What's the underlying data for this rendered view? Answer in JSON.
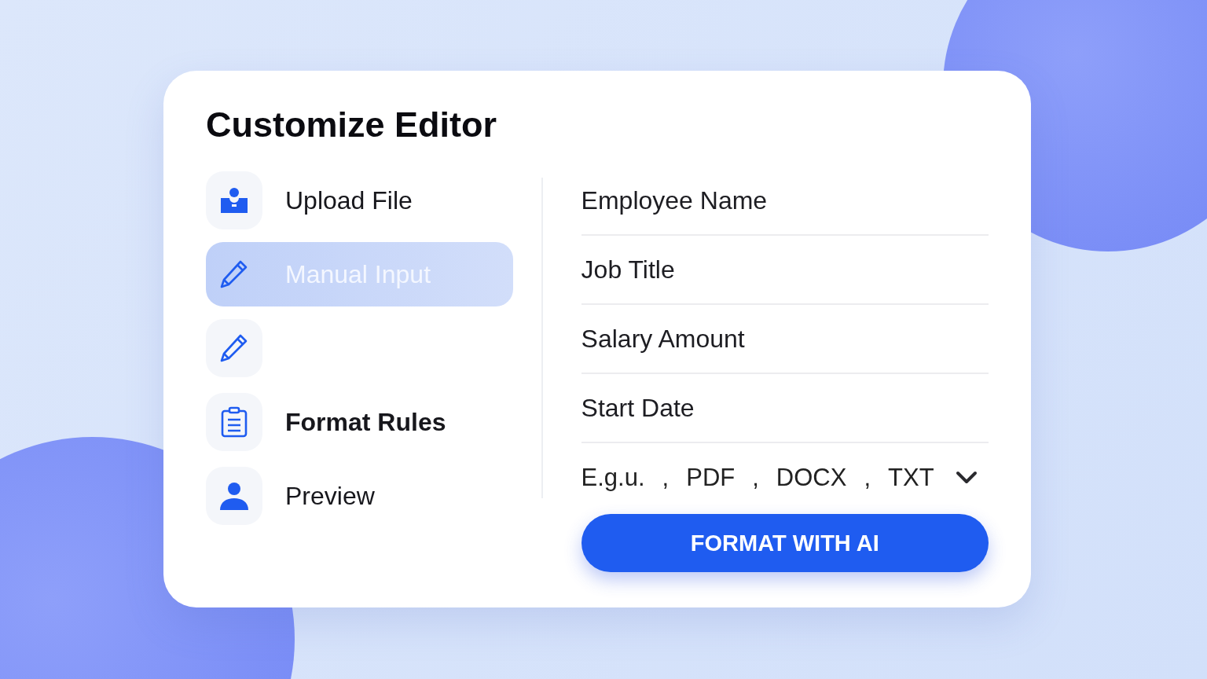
{
  "title": "Customize Editor",
  "menu": [
    {
      "kind": "user-badge",
      "label": "Upload File",
      "selected": false,
      "emphasized": false
    },
    {
      "kind": "pencil",
      "label": "Manual Input",
      "selected": true,
      "emphasized": false
    },
    {
      "kind": "pencil",
      "selected": false
    },
    {
      "kind": "clipboard",
      "label": "Format Rules",
      "selected": false,
      "emphasized": true
    },
    {
      "kind": "person",
      "label": "Preview",
      "selected": false,
      "emphasized": false
    }
  ],
  "fields": [
    {
      "value": "Employee Name"
    },
    {
      "value": "Job Title"
    },
    {
      "value": "Salary Amount"
    },
    {
      "value": "Start Date"
    }
  ],
  "format_select": {
    "parts": [
      "E.g.u.",
      ",",
      "PDF",
      ",",
      "DOCX",
      ",",
      "TXT"
    ]
  },
  "button": "FORMAT WITH AI"
}
